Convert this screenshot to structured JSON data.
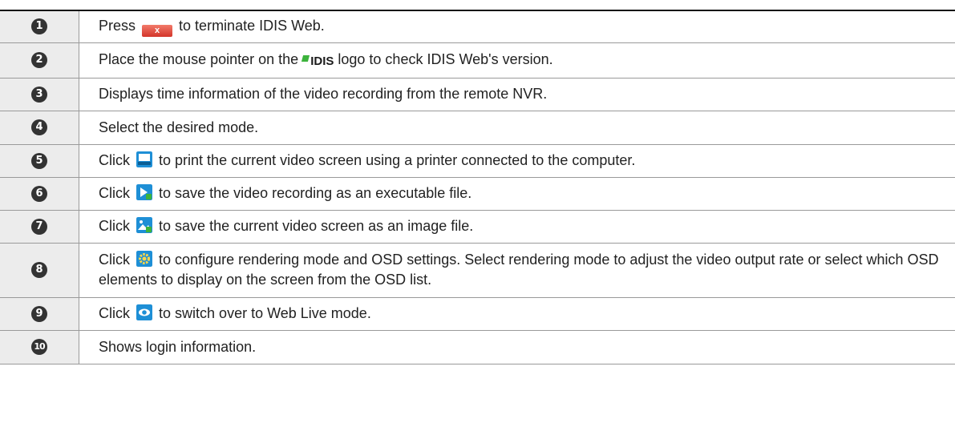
{
  "rows": [
    {
      "num": "1",
      "parts": [
        "Press",
        "to terminate IDIS Web."
      ],
      "icon": "close-icon"
    },
    {
      "num": "2",
      "parts": [
        "Place the mouse pointer on the",
        "logo to check IDIS Web's version."
      ],
      "icon": "idis-logo-icon",
      "logo_text": "IDIS"
    },
    {
      "num": "3",
      "text": "Displays time information of the video recording from the remote NVR."
    },
    {
      "num": "4",
      "text": "Select the desired mode."
    },
    {
      "num": "5",
      "parts": [
        "Click",
        "to print the current video screen using a printer connected to the computer."
      ],
      "icon": "print-icon"
    },
    {
      "num": "6",
      "parts": [
        "Click",
        "to save the video recording as an executable file."
      ],
      "icon": "save-clip-icon"
    },
    {
      "num": "7",
      "parts": [
        "Click",
        "to save the current video screen as an image file."
      ],
      "icon": "save-image-icon"
    },
    {
      "num": "8",
      "parts": [
        "Click",
        "to configure rendering mode and OSD settings. Select rendering mode to adjust the video output rate or select which OSD elements to display on the screen from the OSD list."
      ],
      "icon": "settings-gear-icon"
    },
    {
      "num": "9",
      "parts": [
        "Click",
        "to switch over to Web Live mode."
      ],
      "icon": "web-live-icon"
    },
    {
      "num": "10",
      "text": "Shows login information."
    }
  ],
  "icons": {
    "close_glyph": "x",
    "accent_blue": "#1e8fd6",
    "close_red": "#d3352a",
    "logo_green": "#3cb33c"
  }
}
